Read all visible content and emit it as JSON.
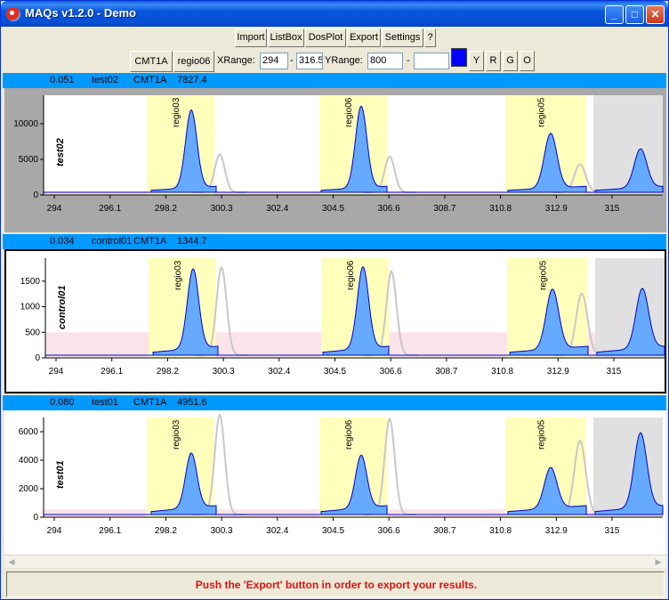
{
  "window": {
    "title": "MAQs v1.2.0 - Demo"
  },
  "menu": {
    "import": "Import",
    "listbox": "ListBox",
    "dosplot": "DosPlot",
    "export": "Export",
    "settings": "Settings",
    "help": "?"
  },
  "toolbar": {
    "gene_button": "CMT1A",
    "region_button": "regio06",
    "xrange_label": "XRange:",
    "xrange_from": "294",
    "xrange_dash": "-",
    "xrange_to": "316.5",
    "yrange_label": "YRange:",
    "yrange_from": "800",
    "yrange_dash": "-",
    "yrange_to": "",
    "swatch_color": "#0000ff",
    "btn_y": "Y",
    "btn_r": "R",
    "btn_g": "G",
    "btn_o": "O"
  },
  "x_ticks": [
    "294",
    "296.1",
    "298.2",
    "300.3",
    "302.4",
    "304.5",
    "306.6",
    "308.7",
    "310.8",
    "312.9",
    "315"
  ],
  "region_labels": [
    "regio03",
    "regio06",
    "regio05"
  ],
  "panels": [
    {
      "score": "0.051",
      "sample": "test02",
      "gene": "CMT1A",
      "value": "7827.4",
      "y_ticks": [
        "0",
        "5000",
        "10000"
      ],
      "y_max": 14000,
      "selected": false,
      "ref_band": 0.0
    },
    {
      "score": "0.034",
      "sample": "control01",
      "gene": "CMT1A",
      "value": "1344.7",
      "y_ticks": [
        "0",
        "500",
        "1000",
        "1500"
      ],
      "y_max": 1950,
      "selected": true,
      "ref_band": 500
    },
    {
      "score": "0.080",
      "sample": "test01",
      "gene": "CMT1A",
      "value": "4951.6",
      "y_ticks": [
        "0",
        "2000",
        "4000",
        "6000"
      ],
      "y_max": 7000,
      "selected": false,
      "ref_band": 550
    }
  ],
  "status": {
    "message": "Push the 'Export' button in order to export your results."
  },
  "colors": {
    "header_bar": "#0099ff",
    "region_fill": "#ffffbb",
    "peak_fill": "#66aaff",
    "peak_stroke": "#0000cc",
    "grey_trace": "#c8c8c8",
    "status_text": "#e01010"
  }
}
